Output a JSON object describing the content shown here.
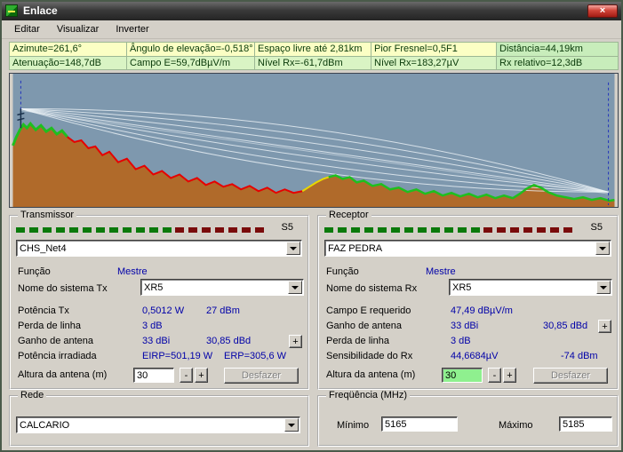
{
  "window": {
    "title": "Enlace",
    "menu": [
      "Editar",
      "Visualizar",
      "Inverter"
    ]
  },
  "icons": {
    "close": "×"
  },
  "info": {
    "row1": [
      "Azimute=261,6°",
      "Ângulo de elevação=-0,518°",
      "Espaço livre até 2,81km",
      "Pior Fresnel=0,5F1",
      "Distância=44,19km"
    ],
    "row2": [
      "Atenuação=148,7dB",
      "Campo E=59,7dBµV/m",
      "Nível Rx=-61,7dBm",
      "Nível Rx=183,27µV",
      "Rx relativo=12,3dB"
    ]
  },
  "tx": {
    "title": "Transmissor",
    "signal": "S5",
    "unit": "CHS_Net4",
    "role_label": "Função",
    "role_value": "Mestre",
    "system_label": "Nome do sistema Tx",
    "system_value": "XR5",
    "rows": [
      {
        "label": "Potência Tx",
        "v1": "0,5012 W",
        "v2": "27 dBm"
      },
      {
        "label": "Perda de linha",
        "v1": "3 dB",
        "v2": ""
      },
      {
        "label": "Ganho de antena",
        "v1": "33 dBi",
        "v2": "30,85 dBd"
      },
      {
        "label": "Potência irradiada",
        "v1": "EIRP=501,19 W",
        "v2": "ERP=305,6 W"
      }
    ],
    "antenna_label": "Altura da antena (m)",
    "antenna_value": "30",
    "undo_label": "Desfazer"
  },
  "rx": {
    "title": "Receptor",
    "signal": "S5",
    "unit": "FAZ PEDRA",
    "role_label": "Função",
    "role_value": "Mestre",
    "system_label": "Nome do sistema Rx",
    "system_value": "XR5",
    "rows": [
      {
        "label": "Campo E requerido",
        "v1": "47,49 dBµV/m",
        "v2": ""
      },
      {
        "label": "Ganho de antena",
        "v1": "33 dBi",
        "v2": "30,85 dBd"
      },
      {
        "label": "Perda de linha",
        "v1": "3 dB",
        "v2": ""
      },
      {
        "label": "Sensibilidade do Rx",
        "v1": "44,6684µV",
        "v2": "-74 dBm"
      }
    ],
    "antenna_label": "Altura da antena (m)",
    "antenna_value": "30",
    "undo_label": "Desfazer"
  },
  "rede": {
    "title": "Rede",
    "value": "CALCARIO"
  },
  "freq": {
    "title": "Freqüência (MHz)",
    "min_label": "Mínimo",
    "min_value": "5165",
    "max_label": "Máximo",
    "max_value": "5185"
  },
  "controls": {
    "plus": "+",
    "minus": "-"
  }
}
